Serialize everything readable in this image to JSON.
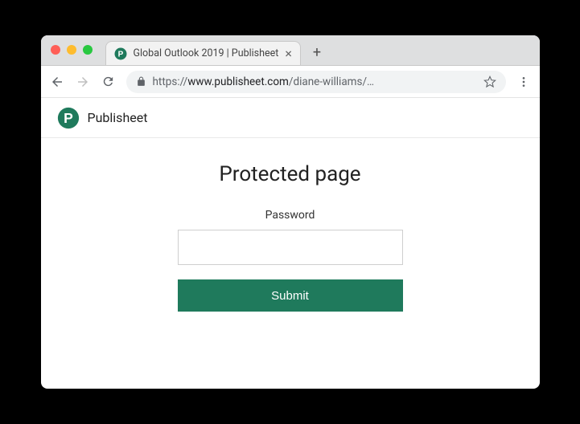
{
  "browser": {
    "tab_title": "Global Outlook 2019 | Publisheet",
    "url_scheme": "https://",
    "url_host": "www.publisheet.com",
    "url_path": "/diane-williams/…"
  },
  "brand": {
    "name": "Publisheet",
    "color": "#1f7a5c"
  },
  "page": {
    "heading": "Protected page",
    "password_label": "Password",
    "password_value": "",
    "submit_label": "Submit"
  }
}
